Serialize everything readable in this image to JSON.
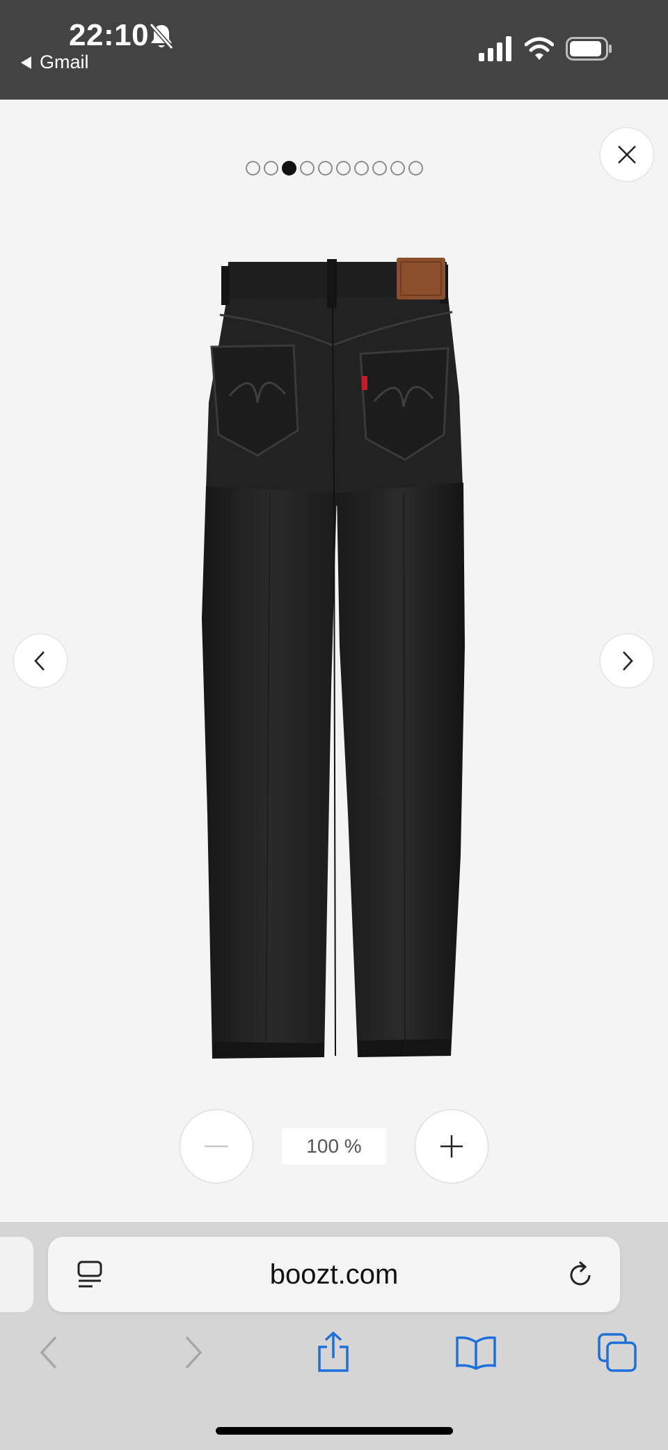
{
  "status_bar": {
    "time": "22:10",
    "back_app_label": "Gmail",
    "icons": [
      "bell-slash-icon",
      "cellular-signal-icon",
      "wifi-icon",
      "battery-icon"
    ]
  },
  "gallery": {
    "dot_count": 10,
    "active_index": 2,
    "zoom_level": "100 %",
    "icons": {
      "close": "close-icon",
      "prev": "chevron-left-icon",
      "next": "chevron-right-icon",
      "zoom_out": "minus-icon",
      "zoom_in": "plus-icon"
    },
    "product_image": "black jeans back view"
  },
  "browser": {
    "url": "boozt.com",
    "icons": [
      "reader-view-icon",
      "reload-icon",
      "back-arrow-icon",
      "forward-arrow-icon",
      "share-icon",
      "bookmarks-icon",
      "tabs-icon"
    ]
  },
  "colors": {
    "status_bar_bg": "#434343",
    "page_bg": "#f4f4f4",
    "browser_bar_bg": "#d5d5d5",
    "accent_blue": "#1e6fd9",
    "disabled_gray": "#a6a6a6",
    "denim": "#1f1f1f"
  }
}
